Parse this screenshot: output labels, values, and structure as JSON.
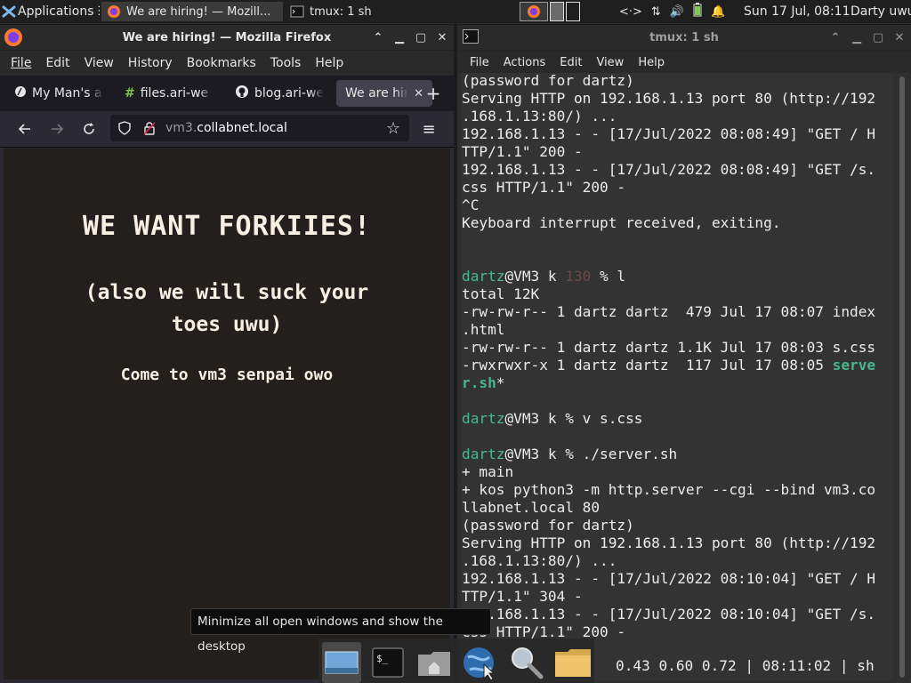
{
  "panel": {
    "applications_label": "Applications",
    "tasks": [
      {
        "label": "We are hiring! — Mozill...",
        "icon": "firefox-icon"
      },
      {
        "label": "tmux: 1 sh",
        "icon": "terminal-icon"
      }
    ],
    "clock": "Sun 17 Jul, 08:11",
    "user": "Darty uwu"
  },
  "firefox": {
    "title": "We are hiring! — Mozilla Firefox",
    "menu": [
      "File",
      "Edit",
      "View",
      "History",
      "Bookmarks",
      "Tools",
      "Help"
    ],
    "tabs": [
      {
        "label": "My Man's a",
        "icon": "globe-icon"
      },
      {
        "label": "files.ari-we",
        "icon": "hash-icon"
      },
      {
        "label": "blog.ari-we",
        "icon": "github-icon"
      },
      {
        "label": "We are hirin",
        "icon": "none",
        "selected": true
      }
    ],
    "url_host_prefix": "vm3.",
    "url_domain": "collabnet.local",
    "page": {
      "heading": "WE WANT FORKIIES!",
      "subheading": "(also we will suck your toes uwu)",
      "paragraph": "Come to vm3 senpai owo"
    }
  },
  "terminal": {
    "title": "tmux: 1 sh",
    "menu": [
      "File",
      "Actions",
      "Edit",
      "View",
      "Help"
    ],
    "lines": [
      "(password for dartz)",
      "Serving HTTP on 192.168.1.13 port 80 (http://192",
      ".168.1.13:80/) ...",
      "192.168.1.13 - - [17/Jul/2022 08:08:49] \"GET / H",
      "TTP/1.1\" 200 -",
      "192.168.1.13 - - [17/Jul/2022 08:08:49] \"GET /s.",
      "css HTTP/1.1\" 200 -",
      "^C",
      "Keyboard interrupt received, exiting.",
      "",
      "",
      "PROMPT1",
      "total 12K",
      "-rw-rw-r-- 1 dartz dartz  479 Jul 17 08:07 index",
      ".html",
      "-rw-rw-r-- 1 dartz dartz 1.1K Jul 17 08:03 s.css",
      "EXE1",
      "EXE2",
      "",
      "PROMPT2",
      "",
      "PROMPT3",
      "+ main",
      "+ kos python3 -m http.server --cgi --bind vm3.co",
      "llabnet.local 80",
      "(password for dartz)",
      "Serving HTTP on 192.168.1.13 port 80 (http://192",
      ".168.1.13:80/) ...",
      "192.168.1.13 - - [17/Jul/2022 08:10:04] \"GET / H",
      "TTP/1.1\" 304 -",
      "192.168.1.13 - - [17/Jul/2022 08:10:04] \"GET /s.",
      "css HTTP/1.1\" 200 -"
    ],
    "prompt_user": "dartz",
    "prompt_host": "@VM3 k ",
    "prompt1_code": "130",
    "prompt1_rest": " % l",
    "prompt2_rest": "% v s.css",
    "prompt3_rest": "% ./server.sh",
    "exe_line_prefix": "-rwxrwxr-x 1 dartz dartz  117 Jul 17 08:05 ",
    "exe_name_a": "serve",
    "exe_name_b": "r.sh",
    "exe_suffix": "*",
    "status": "0.43 0.60 0.72 | 08:11:02 | sh"
  },
  "dock": {
    "items": [
      "show-desktop",
      "terminal",
      "home-folder",
      "web-browser",
      "search",
      "files"
    ],
    "tooltip": "Minimize all open windows and show the desktop"
  },
  "colors": {
    "page_bg": "#231f1c",
    "page_text": "#f6efe2",
    "prompt_green": "#49b68d",
    "terminal_bg": "#333333"
  }
}
